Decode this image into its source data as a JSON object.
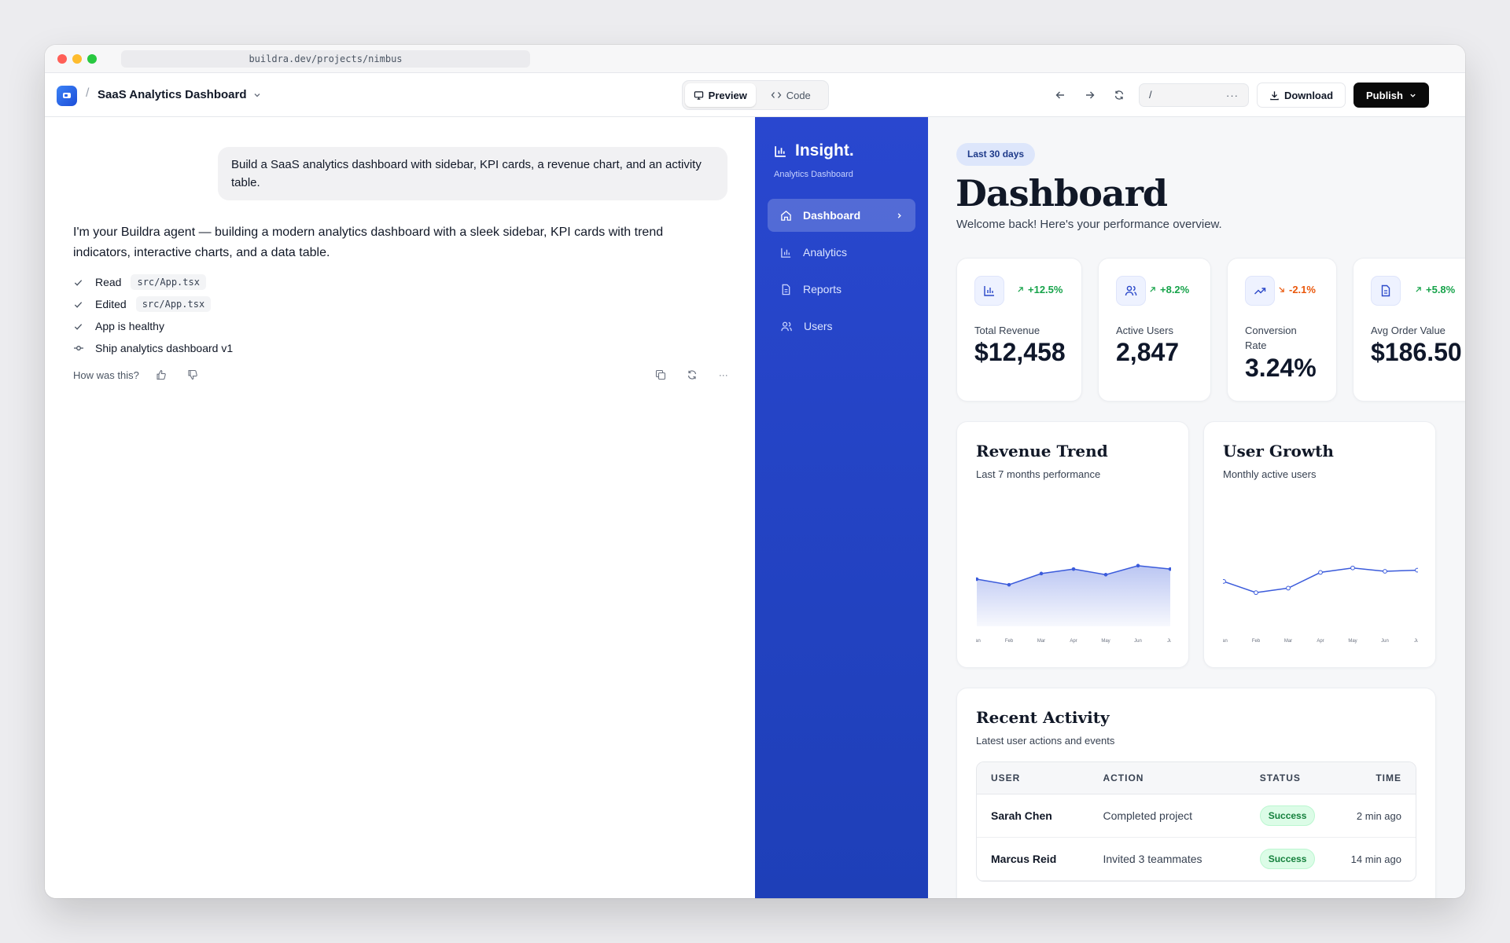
{
  "browser": {
    "url": "buildra.dev/projects/nimbus"
  },
  "toolbar": {
    "project_name": "SaaS Analytics Dashboard",
    "separator": "/",
    "preview_label": "Preview",
    "code_label": "Code",
    "path_value": "/",
    "more_label": "···",
    "download_label": "Download",
    "publish_label": "Publish"
  },
  "chat": {
    "user_message": "Build a SaaS analytics dashboard with sidebar, KPI cards, a revenue chart, and an activity table.",
    "agent_reply": "I'm your Buildra agent — building a modern analytics dashboard with a sleek sidebar, KPI cards with trend indicators, interactive charts, and a data table.",
    "steps": [
      {
        "label": "Read",
        "file": "src/App.tsx",
        "icon": "check-icon"
      },
      {
        "label": "Edited",
        "file": "src/App.tsx",
        "icon": "check-icon"
      },
      {
        "label": "App is healthy",
        "icon": "check-icon"
      },
      {
        "label": "Ship analytics dashboard v1",
        "icon": "commit-icon"
      }
    ],
    "feedback_prompt": "How was this?",
    "more_label": "···"
  },
  "app": {
    "brand": "Insight.",
    "brand_sub": "Analytics Dashboard",
    "nav": [
      {
        "label": "Dashboard",
        "icon": "home-icon",
        "active": true
      },
      {
        "label": "Analytics",
        "icon": "bar-chart-icon"
      },
      {
        "label": "Reports",
        "icon": "file-icon"
      },
      {
        "label": "Users",
        "icon": "users-icon"
      }
    ],
    "range_pill": "Last 30 days",
    "title": "Dashboard",
    "welcome": "Welcome back! Here's your performance overview.",
    "kpis": [
      {
        "label": "Total Revenue",
        "value": "$12,458",
        "delta": "+12.5%",
        "trend": "up",
        "icon": "bar-chart-icon"
      },
      {
        "label": "Active Users",
        "value": "2,847",
        "delta": "+8.2%",
        "trend": "up",
        "icon": "users-icon"
      },
      {
        "label": "Conversion Rate",
        "value": "3.24%",
        "delta": "-2.1%",
        "trend": "down",
        "icon": "trend-up-icon"
      },
      {
        "label": "Avg Order Value",
        "value": "$186.50",
        "delta": "+5.8%",
        "trend": "up",
        "icon": "file-icon"
      }
    ],
    "revenue_card": {
      "title": "Revenue Trend",
      "subtitle": "Last 7 months performance"
    },
    "growth_card": {
      "title": "User Growth",
      "subtitle": "Monthly active users"
    },
    "activity": {
      "title": "Recent Activity",
      "subtitle": "Latest user actions and events",
      "columns": [
        "USER",
        "ACTION",
        "STATUS",
        "TIME"
      ],
      "rows": [
        {
          "user": "Sarah Chen",
          "action": "Completed project",
          "status": "Success",
          "time": "2 min ago"
        },
        {
          "user": "Marcus Reid",
          "action": "Invited 3 teammates",
          "status": "Success",
          "time": "14 min ago"
        }
      ]
    },
    "colors": {
      "accent": "#2947cf",
      "positive": "#16a34a",
      "negative": "#ea580c"
    }
  },
  "chart_data": [
    {
      "type": "area",
      "categories": [
        "Jan",
        "Feb",
        "Mar",
        "Apr",
        "May",
        "Jun",
        "Jul"
      ],
      "series": [
        {
          "values": [
            42,
            37,
            47,
            51,
            46,
            54,
            51
          ]
        }
      ],
      "ylim": [
        0,
        70
      ],
      "color": "#3b5bdb"
    },
    {
      "type": "line",
      "categories": [
        "Jan",
        "Feb",
        "Mar",
        "Apr",
        "May",
        "Jun",
        "Jul"
      ],
      "series": [
        {
          "values": [
            40,
            30,
            34,
            48,
            52,
            49,
            50
          ]
        }
      ],
      "ylim": [
        0,
        70
      ],
      "color": "#3b5bdb"
    }
  ]
}
